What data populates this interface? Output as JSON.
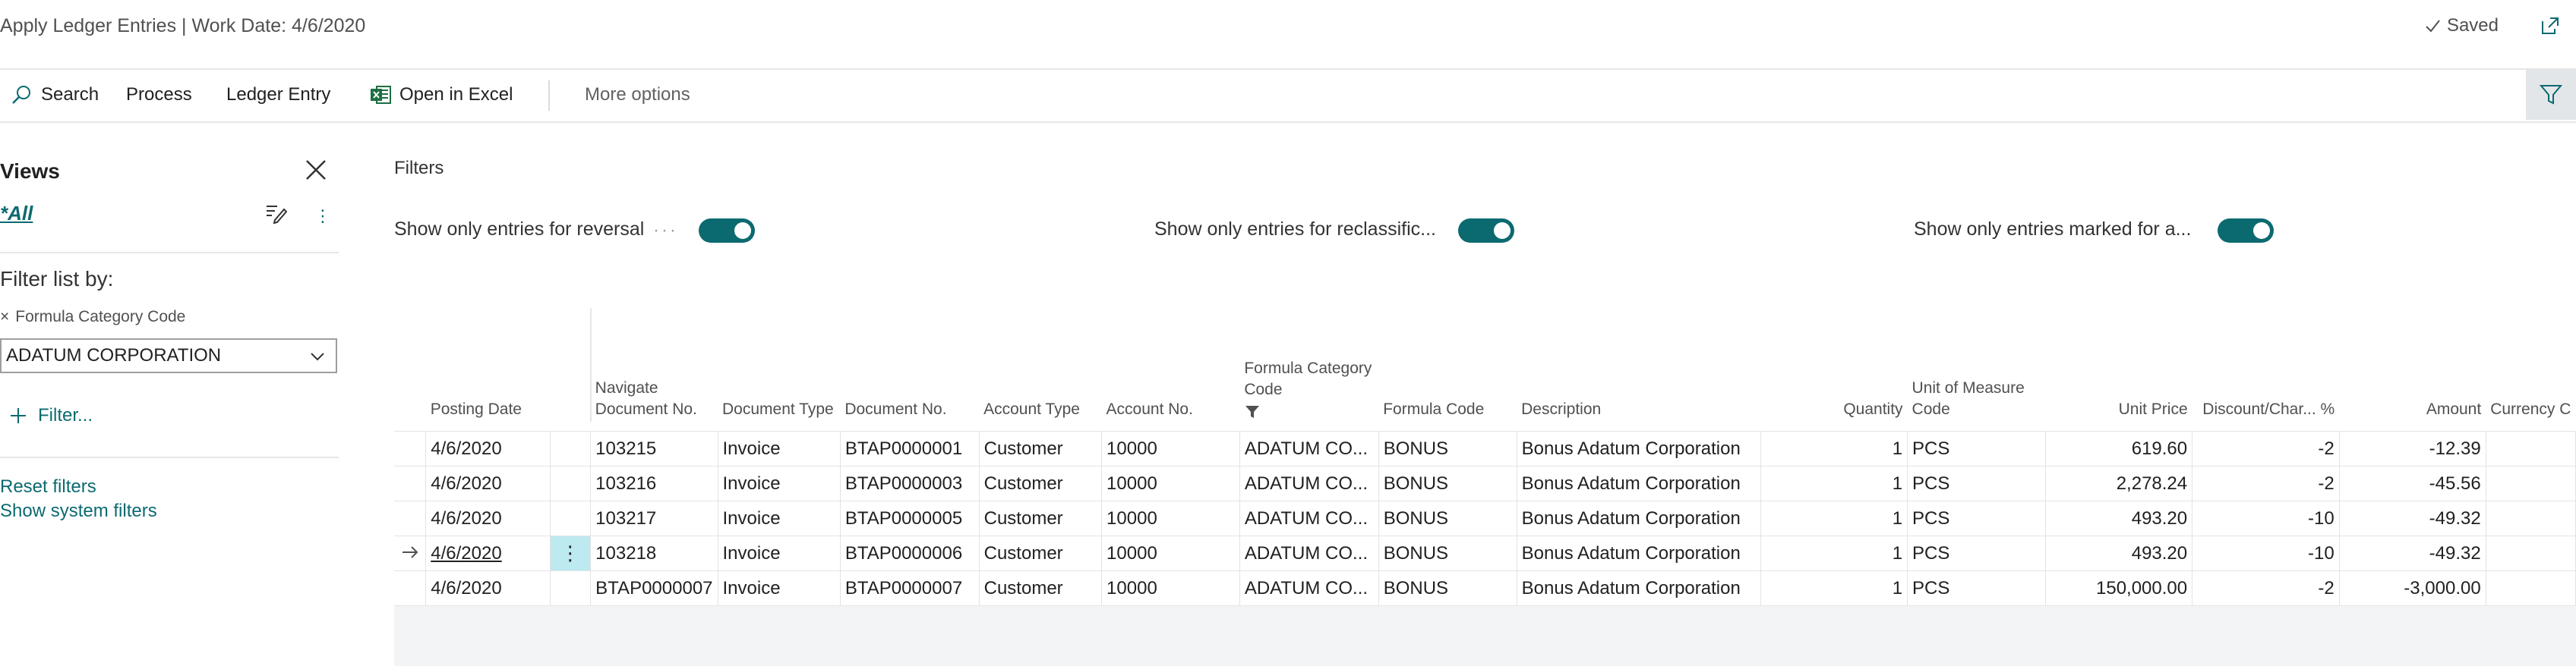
{
  "window": {
    "title": "Apply Ledger Entries | Work Date: 4/6/2020",
    "status": "Saved"
  },
  "actions": {
    "search": "Search",
    "process": "Process",
    "ledger_entry": "Ledger Entry",
    "open_in_excel": "Open in Excel",
    "more_options": "More options"
  },
  "views": {
    "title": "Views",
    "current": "*All",
    "filter_list_by": "Filter list by:",
    "field_filter": {
      "label": "Formula Category Code",
      "value": "ADATUM CORPORATION"
    },
    "add_filter": "Filter...",
    "reset_filters": "Reset filters",
    "show_system_filters": "Show system filters"
  },
  "filters": {
    "title": "Filters",
    "toggles": [
      {
        "label": "Show only entries for reversal",
        "on": true
      },
      {
        "label": "Show only entries for reclassific...",
        "on": true
      },
      {
        "label": "Show only entries marked for a...",
        "on": true
      }
    ]
  },
  "grid": {
    "headers": {
      "posting_date": "Posting Date",
      "nav_doc_no": "Navigate Document No.",
      "doc_type": "Document Type",
      "doc_no": "Document No.",
      "acc_type": "Account Type",
      "acc_no": "Account No.",
      "formula_cat": "Formula Category Code",
      "formula_code": "Formula Code",
      "description": "Description",
      "quantity": "Quantity",
      "uom": "Unit of Measure Code",
      "unit_price": "Unit Price",
      "discount": "Discount/Char... %",
      "amount": "Amount",
      "currency": "Currency C"
    },
    "rows": [
      {
        "posting_date": "4/6/2020",
        "nav_doc_no": "103215",
        "doc_type": "Invoice",
        "doc_no": "BTAP0000001",
        "acc_type": "Customer",
        "acc_no": "10000",
        "formula_cat": "ADATUM CO...",
        "formula_code": "BONUS",
        "description": "Bonus Adatum Corporation",
        "quantity": "1",
        "uom": "PCS",
        "unit_price": "619.60",
        "discount": "-2",
        "amount": "-12.39",
        "currency": "",
        "current": false
      },
      {
        "posting_date": "4/6/2020",
        "nav_doc_no": "103216",
        "doc_type": "Invoice",
        "doc_no": "BTAP0000003",
        "acc_type": "Customer",
        "acc_no": "10000",
        "formula_cat": "ADATUM CO...",
        "formula_code": "BONUS",
        "description": "Bonus Adatum Corporation",
        "quantity": "1",
        "uom": "PCS",
        "unit_price": "2,278.24",
        "discount": "-2",
        "amount": "-45.56",
        "currency": "",
        "current": false
      },
      {
        "posting_date": "4/6/2020",
        "nav_doc_no": "103217",
        "doc_type": "Invoice",
        "doc_no": "BTAP0000005",
        "acc_type": "Customer",
        "acc_no": "10000",
        "formula_cat": "ADATUM CO...",
        "formula_code": "BONUS",
        "description": "Bonus Adatum Corporation",
        "quantity": "1",
        "uom": "PCS",
        "unit_price": "493.20",
        "discount": "-10",
        "amount": "-49.32",
        "currency": "",
        "current": false
      },
      {
        "posting_date": "4/6/2020",
        "nav_doc_no": "103218",
        "doc_type": "Invoice",
        "doc_no": "BTAP0000006",
        "acc_type": "Customer",
        "acc_no": "10000",
        "formula_cat": "ADATUM CO...",
        "formula_code": "BONUS",
        "description": "Bonus Adatum Corporation",
        "quantity": "1",
        "uom": "PCS",
        "unit_price": "493.20",
        "discount": "-10",
        "amount": "-49.32",
        "currency": "",
        "current": true
      },
      {
        "posting_date": "4/6/2020",
        "nav_doc_no": "BTAP0000007",
        "doc_type": "Invoice",
        "doc_no": "BTAP0000007",
        "acc_type": "Customer",
        "acc_no": "10000",
        "formula_cat": "ADATUM CO...",
        "formula_code": "BONUS",
        "description": "Bonus Adatum Corporation",
        "quantity": "1",
        "uom": "PCS",
        "unit_price": "150,000.00",
        "discount": "-2",
        "amount": "-3,000.00",
        "currency": "",
        "current": false
      }
    ]
  },
  "colors": {
    "accent": "#0b6a70",
    "active_cell": "#bde9f0",
    "excel_green": "#1d6f42"
  }
}
